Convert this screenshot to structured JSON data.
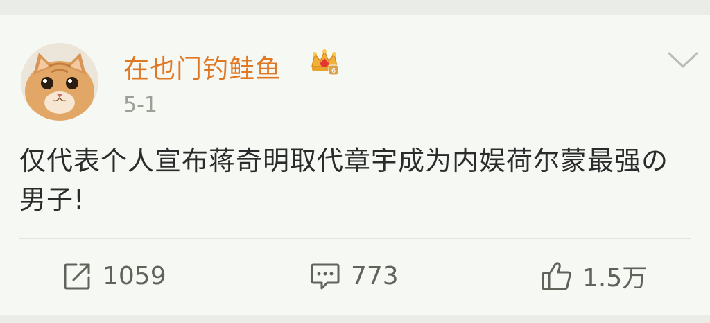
{
  "post": {
    "username": "在也门钓鲑鱼",
    "vip_level": "6",
    "time": "5-1",
    "content": "仅代表个人宣布蒋奇明取代章宇成为内娱荷尔蒙最强の男子!"
  },
  "actions": {
    "repost_count": "1059",
    "comment_count": "773",
    "like_count": "1.5万"
  },
  "colors": {
    "username": "#e07823",
    "text": "#2b2b2b",
    "meta": "#9ba096",
    "icon": "#5f645b",
    "card_bg": "#f6f8f4",
    "page_bg": "#e9ece7"
  },
  "icons": {
    "badge": "crown-vip-icon",
    "menu": "chevron-down-icon",
    "repost": "repost-icon",
    "comment": "comment-icon",
    "like": "thumbs-up-icon"
  }
}
